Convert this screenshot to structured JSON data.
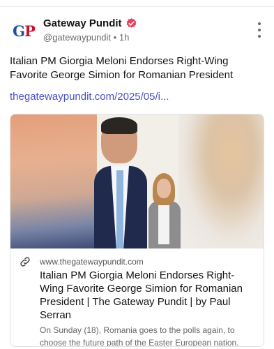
{
  "post": {
    "author": {
      "avatar_text_g": "G",
      "avatar_text_p": "P",
      "display_name": "Gateway Pundit",
      "handle": "@gatewaypundit",
      "separator": "•",
      "time": "1h",
      "verified_icon": "verified-badge-icon",
      "verified_color": "#e8415f"
    },
    "text": "Italian PM Giorgia Meloni Endorses Right-Wing Favorite George Simion for Romanian President",
    "link_text": "thegatewaypundit.com/2025/05/i...",
    "more_icon": "more-vertical-icon"
  },
  "card": {
    "image_description_icon": "article-photo",
    "link_icon": "link-icon",
    "domain": "www.thegatewaypundit.com",
    "title": "Italian PM Giorgia Meloni Endorses Right-Wing Favorite George Simion for Romanian President | The Gateway Pundit | by Paul Serran",
    "description": "On Sunday (18), Romania goes to the polls again, to choose the future path of the Easter European nation."
  },
  "colors": {
    "link": "#4a4fc7",
    "brand_blue": "#1f4e9e",
    "brand_red": "#c8102e"
  }
}
